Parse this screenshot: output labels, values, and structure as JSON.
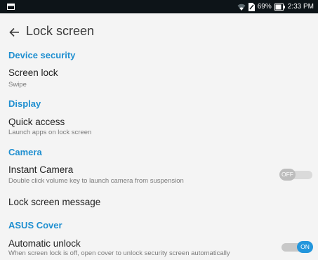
{
  "status_bar": {
    "battery_percent": "69%",
    "time": "2:33 PM",
    "icons": [
      "notification-icon",
      "wifi-icon",
      "sim-icon",
      "battery-icon"
    ]
  },
  "header": {
    "title": "Lock screen",
    "back_icon": "arrow-left-icon"
  },
  "sections": {
    "device_security": "Device security",
    "display": "Display",
    "camera": "Camera",
    "asus_cover": "ASUS Cover"
  },
  "items": {
    "screen_lock": {
      "title": "Screen lock",
      "summary": "Swipe"
    },
    "quick_access": {
      "title": "Quick access",
      "summary": "Launch apps on lock screen"
    },
    "instant_camera": {
      "title": "Instant Camera",
      "summary": "Double click volume key to launch camera from suspension",
      "toggle": "OFF"
    },
    "lock_screen_message": {
      "title": "Lock screen message"
    },
    "automatic_unlock": {
      "title": "Automatic unlock",
      "summary": "When screen lock is off, open cover to unlock security screen automatically",
      "toggle": "ON"
    }
  },
  "colors": {
    "accent": "#1f8fd0",
    "toggle_on": "#2396dc",
    "status_bar": "#0d1418",
    "background": "#f4f4f4"
  }
}
